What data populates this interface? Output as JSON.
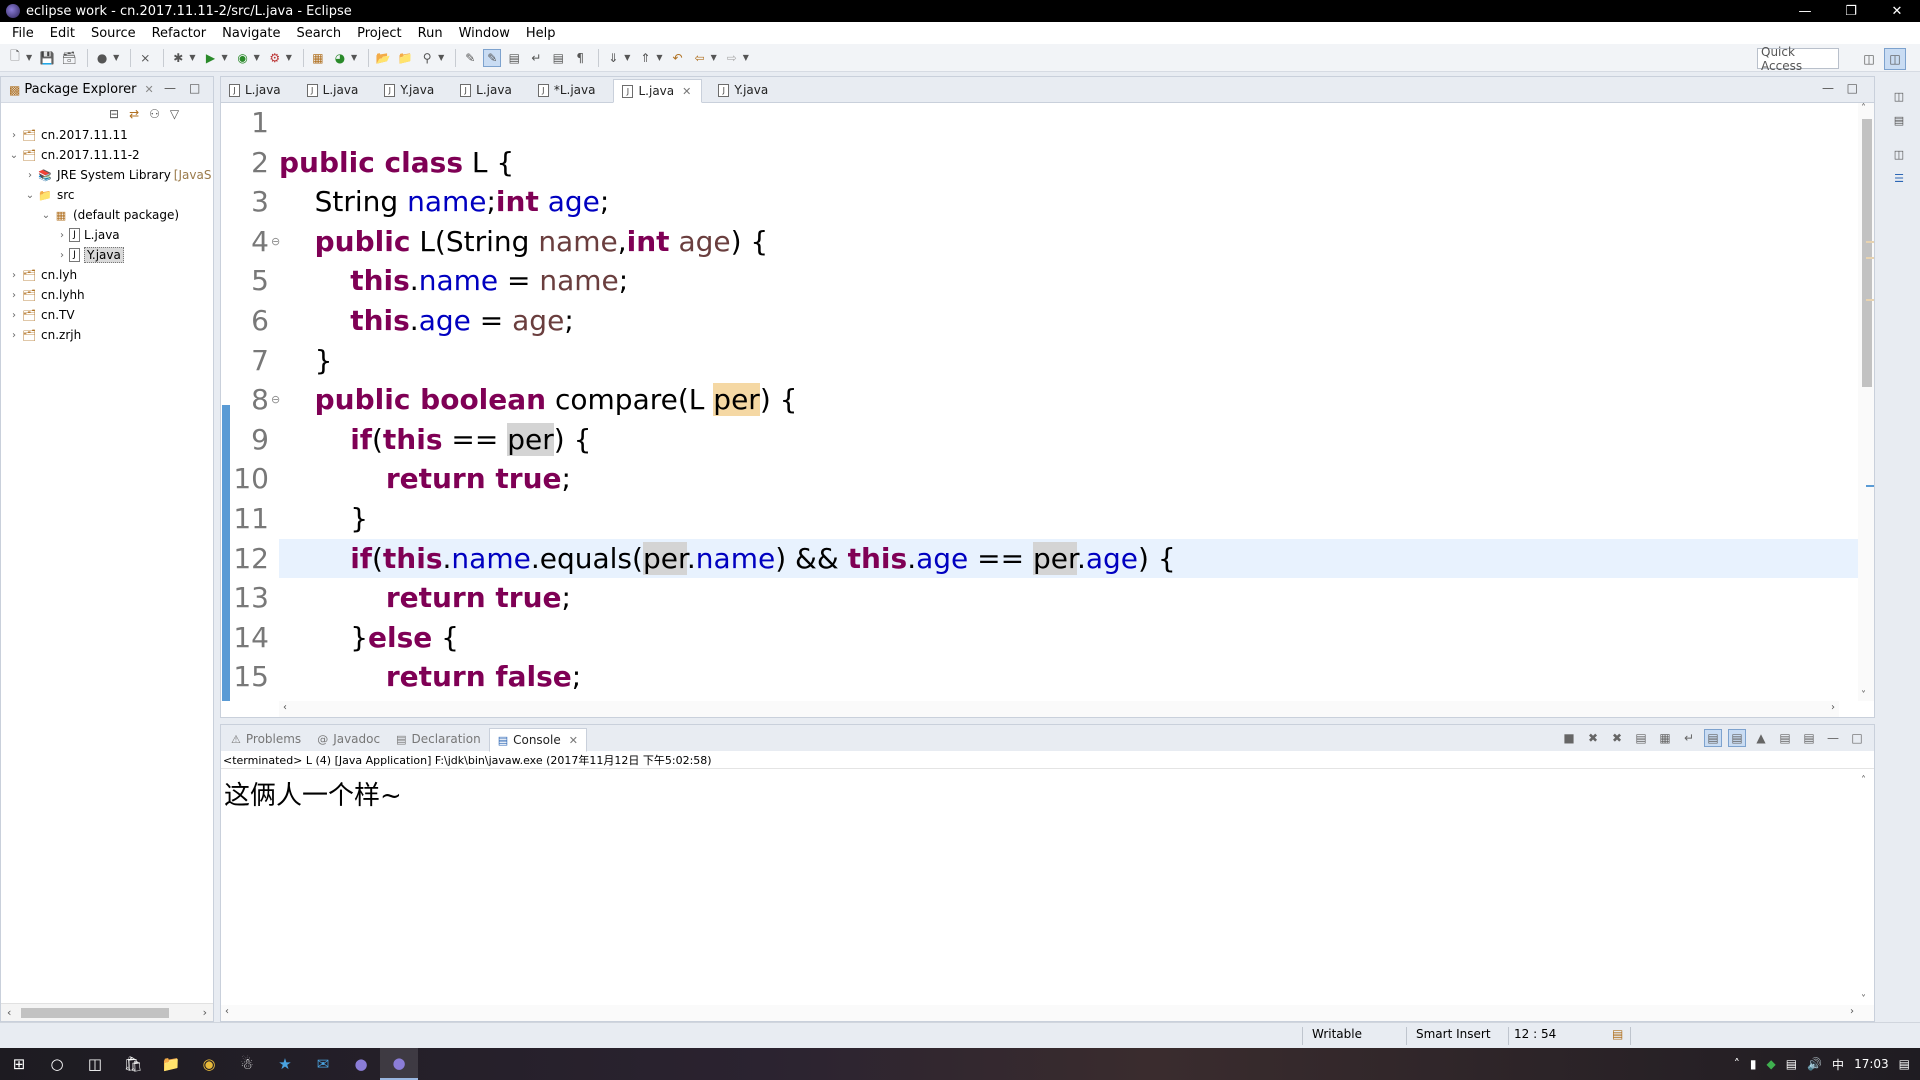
{
  "window": {
    "title": "eclipse work - cn.2017.11.11-2/src/L.java - Eclipse",
    "minimize_icon": "minimize",
    "restore_icon": "restore",
    "close_icon": "close"
  },
  "menu": [
    "File",
    "Edit",
    "Source",
    "Refactor",
    "Navigate",
    "Search",
    "Project",
    "Run",
    "Window",
    "Help"
  ],
  "toolbar": {
    "quick_access": "Quick Access"
  },
  "package_explorer": {
    "title": "Package Explorer",
    "tree": [
      {
        "label": "cn.2017.11.11",
        "twisty": "›",
        "icon": "project",
        "depth": 0
      },
      {
        "label": "cn.2017.11.11-2",
        "twisty": "⌄",
        "icon": "project",
        "depth": 0
      },
      {
        "label": "JRE System Library",
        "decoration": "[JavaS",
        "twisty": "›",
        "icon": "library",
        "depth": 1
      },
      {
        "label": "src",
        "twisty": "⌄",
        "icon": "folder",
        "depth": 1
      },
      {
        "label": "(default package)",
        "twisty": "⌄",
        "icon": "package",
        "depth": 2
      },
      {
        "label": "L.java",
        "twisty": "›",
        "icon": "java-file",
        "depth": 3
      },
      {
        "label": "Y.java",
        "twisty": "›",
        "icon": "java-file",
        "depth": 3,
        "selected": true
      },
      {
        "label": "cn.lyh",
        "twisty": "›",
        "icon": "project",
        "depth": 0
      },
      {
        "label": "cn.lyhh",
        "twisty": "›",
        "icon": "project",
        "depth": 0
      },
      {
        "label": "cn.TV",
        "twisty": "›",
        "icon": "project",
        "depth": 0
      },
      {
        "label": "cn.zrjh",
        "twisty": "›",
        "icon": "project",
        "depth": 0
      }
    ]
  },
  "editor": {
    "tabs": [
      {
        "label": "L.java",
        "active": false
      },
      {
        "label": "L.java",
        "active": false
      },
      {
        "label": "Y.java",
        "active": false
      },
      {
        "label": "L.java",
        "active": false
      },
      {
        "label": "*L.java",
        "active": false
      },
      {
        "label": "L.java",
        "active": true
      },
      {
        "label": "Y.java",
        "active": false
      }
    ],
    "current_line": 12,
    "lines": [
      {
        "n": "1",
        "fold": "",
        "tokens": []
      },
      {
        "n": "2",
        "fold": "",
        "tokens": [
          [
            "kw",
            "public class"
          ],
          [
            "",
            " L {"
          ]
        ]
      },
      {
        "n": "3",
        "fold": "",
        "tokens": [
          [
            "",
            "    String "
          ],
          [
            "fld",
            "name"
          ],
          [
            "",
            ";"
          ],
          [
            "kw",
            "int"
          ],
          [
            "",
            ""
          ],
          [
            "fld",
            " age"
          ],
          [
            "",
            ";"
          ]
        ]
      },
      {
        "n": "4",
        "fold": "⊖",
        "tokens": [
          [
            "",
            "    "
          ],
          [
            "kw",
            "public"
          ],
          [
            "",
            " L(String "
          ],
          [
            "loc",
            "name"
          ],
          [
            "",
            ","
          ],
          [
            "kw",
            "int"
          ],
          [
            "",
            ""
          ],
          [
            "loc",
            " age"
          ],
          [
            "",
            ") {"
          ]
        ]
      },
      {
        "n": "5",
        "fold": "",
        "tokens": [
          [
            "",
            "        "
          ],
          [
            "kw",
            "this"
          ],
          [
            "",
            "."
          ],
          [
            "fld",
            "name"
          ],
          [
            "",
            " = "
          ],
          [
            "loc",
            "name"
          ],
          [
            "",
            ";"
          ]
        ]
      },
      {
        "n": "6",
        "fold": "",
        "tokens": [
          [
            "",
            "        "
          ],
          [
            "kw",
            "this"
          ],
          [
            "",
            "."
          ],
          [
            "fld",
            "age"
          ],
          [
            "",
            " = "
          ],
          [
            "loc",
            "age"
          ],
          [
            "",
            ";"
          ]
        ]
      },
      {
        "n": "7",
        "fold": "",
        "tokens": [
          [
            "",
            "    }"
          ]
        ]
      },
      {
        "n": "8",
        "fold": "⊖",
        "tokens": [
          [
            "",
            "    "
          ],
          [
            "kw",
            "public boolean"
          ],
          [
            "",
            " compare(L "
          ],
          [
            "occ-w",
            "per"
          ],
          [
            "",
            ") {"
          ]
        ]
      },
      {
        "n": "9",
        "fold": "",
        "tokens": [
          [
            "",
            "        "
          ],
          [
            "kw",
            "if"
          ],
          [
            "",
            "("
          ],
          [
            "kw",
            "this"
          ],
          [
            "",
            " == "
          ],
          [
            "occ-r",
            "per"
          ],
          [
            "",
            ") {"
          ]
        ]
      },
      {
        "n": "10",
        "fold": "",
        "tokens": [
          [
            "",
            "            "
          ],
          [
            "kw",
            "return true"
          ],
          [
            "",
            ";"
          ]
        ]
      },
      {
        "n": "11",
        "fold": "",
        "tokens": [
          [
            "",
            "        }"
          ]
        ]
      },
      {
        "n": "12",
        "fold": "",
        "tokens": [
          [
            "",
            "        "
          ],
          [
            "kw",
            "if"
          ],
          [
            "",
            "("
          ],
          [
            "kw",
            "this"
          ],
          [
            "",
            "."
          ],
          [
            "fld",
            "name"
          ],
          [
            "",
            ".equals("
          ],
          [
            "occ-r",
            "per"
          ],
          [
            "",
            "."
          ],
          [
            "fld",
            "name"
          ],
          [
            "",
            ") && "
          ],
          [
            "kw",
            "this"
          ],
          [
            "",
            "."
          ],
          [
            "fld",
            "age"
          ],
          [
            "",
            " == "
          ],
          [
            "occ-r",
            "per"
          ],
          [
            "",
            "."
          ],
          [
            "fld",
            "age"
          ],
          [
            "",
            ") {"
          ]
        ]
      },
      {
        "n": "13",
        "fold": "",
        "tokens": [
          [
            "",
            "            "
          ],
          [
            "kw",
            "return true"
          ],
          [
            "",
            ";"
          ]
        ]
      },
      {
        "n": "14",
        "fold": "",
        "tokens": [
          [
            "",
            "        }"
          ],
          [
            "kw",
            "else"
          ],
          [
            "",
            " {"
          ]
        ]
      },
      {
        "n": "15",
        "fold": "",
        "tokens": [
          [
            "",
            "            "
          ],
          [
            "kw",
            "return false"
          ],
          [
            "",
            ";"
          ]
        ]
      }
    ]
  },
  "console": {
    "tabs": [
      {
        "label": "Problems",
        "icon": "problems-icon",
        "active": false
      },
      {
        "label": "Javadoc",
        "icon": "javadoc-icon",
        "active": false
      },
      {
        "label": "Declaration",
        "icon": "declaration-icon",
        "active": false
      },
      {
        "label": "Console",
        "icon": "console-icon",
        "active": true
      }
    ],
    "status": "<terminated> L (4) [Java Application] F:\\jdk\\bin\\javaw.exe (2017年11月12日 下午5:02:58)",
    "output": "这俩人一个样~"
  },
  "statusbar": {
    "writable": "Writable",
    "insert_mode": "Smart Insert",
    "position": "12 : 54"
  },
  "taskbar": {
    "clock": "17:03",
    "ime": "中"
  },
  "colors": {
    "keyword": "#7f0055",
    "field": "#0000c0",
    "local": "#6a3e3e",
    "current_line": "#e8f2fe",
    "write_occurrence": "#f5d8a4",
    "read_occurrence": "#d4d4d4"
  }
}
